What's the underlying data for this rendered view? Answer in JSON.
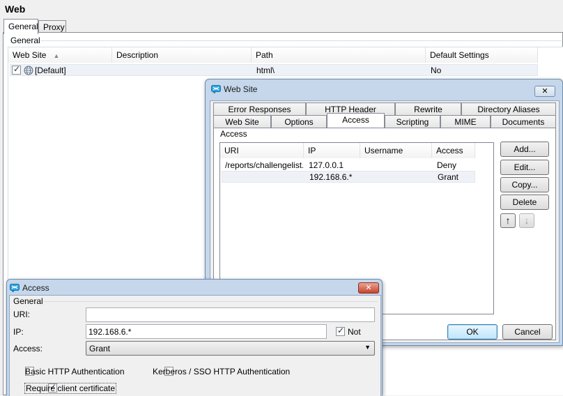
{
  "page": {
    "title": "Web"
  },
  "tabs": [
    {
      "label": "General"
    },
    {
      "label": "Proxy"
    }
  ],
  "general": {
    "group_label": "General",
    "sites_table": {
      "columns": [
        "Web Site",
        "Description",
        "Path",
        "Default Settings"
      ],
      "rows": [
        {
          "checked": true,
          "site": "[Default]",
          "description": "",
          "path": "html\\",
          "default_settings": "No"
        }
      ]
    }
  },
  "website_dialog": {
    "title": "Web Site",
    "tabs_row1": [
      "Error Responses",
      "HTTP Header",
      "Rewrite",
      "Directory Aliases"
    ],
    "tabs_row2": [
      "Web Site",
      "Options",
      "Access",
      "Scripting",
      "MIME",
      "Documents"
    ],
    "active_tab": "Access",
    "access_group_label": "Access",
    "access_table": {
      "columns": [
        "URI",
        "IP",
        "Username",
        "Access"
      ],
      "rows": [
        {
          "uri": "/reports/challengelist...",
          "ip": "127.0.0.1",
          "username": "",
          "access": "Deny"
        },
        {
          "uri": "",
          "ip": "192.168.6.*",
          "username": "",
          "access": "Grant"
        }
      ]
    },
    "buttons": {
      "add": "Add...",
      "edit": "Edit...",
      "copy": "Copy...",
      "delete": "Delete"
    },
    "ok": "OK",
    "cancel": "Cancel"
  },
  "access_dialog": {
    "title": "Access",
    "group_label": "General",
    "uri_label": "URI:",
    "uri_value": "",
    "ip_label": "IP:",
    "ip_value": "192.168.6.*",
    "not_label": "Not",
    "not_checked": true,
    "access_label": "Access:",
    "access_value": "Grant",
    "basic_auth_label": "Basic HTTP Authentication",
    "basic_auth_checked": false,
    "kerberos_label": "Kerberos / SSO HTTP Authentication",
    "kerberos_checked": false,
    "client_cert_label": "Require client certificate",
    "client_cert_checked": true
  }
}
